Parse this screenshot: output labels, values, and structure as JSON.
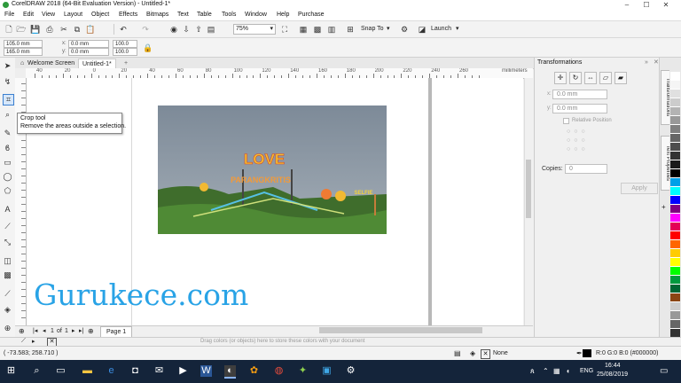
{
  "window": {
    "title": "CorelDRAW 2018 (64-Bit Evaluation Version) - Untitled-1*",
    "controls": [
      "–",
      "☐",
      "✕"
    ]
  },
  "menu": [
    "File",
    "Edit",
    "View",
    "Layout",
    "Object",
    "Effects",
    "Bitmaps",
    "Text",
    "Table",
    "Tools",
    "Window",
    "Help",
    "Purchase"
  ],
  "toolbar": {
    "zoom": "75%",
    "snap_to": "Snap To",
    "launch": "Launch"
  },
  "propbar": {
    "width": "105.0 mm",
    "height": "165.0 mm",
    "x": "0.0 mm",
    "y": "0.0 mm",
    "ox": "100.0",
    "oy": "100.0",
    "angle": "0.0"
  },
  "tabs": {
    "welcome": "Welcome Screen",
    "doc": "Untitled-1*",
    "add": "+"
  },
  "ruler": {
    "labels": [
      "40",
      "20",
      "0",
      "20",
      "40",
      "60",
      "80",
      "100",
      "120",
      "140",
      "160",
      "180",
      "200",
      "220",
      "240",
      "260"
    ],
    "unit": "millimeters"
  },
  "tooltip": {
    "title": "Crop tool",
    "description": "Remove the areas outside a selection."
  },
  "watermark": "Gurukece.com",
  "photo": {
    "sign_love": "LOVE",
    "sign_sub": "PARANGKRITIS",
    "sign_selfie": "SELFIE"
  },
  "pagenav": {
    "current": "1",
    "of": "of",
    "total": "1",
    "page_tab": "Page 1"
  },
  "docker": {
    "title": "Transformations",
    "x": "0.0 mm",
    "y": "0.0 mm",
    "relative": "Relative Position",
    "copies_label": "Copies:",
    "copies": "0",
    "apply": "Apply"
  },
  "side_tabs": {
    "transformations": "Transformations",
    "text_properties": "Text Properties"
  },
  "palette": {
    "colors": [
      "#ffffff",
      "#f5f5f5",
      "#e0e0e0",
      "#cccccc",
      "#b3b3b3",
      "#999999",
      "#808080",
      "#666666",
      "#4d4d4d",
      "#333333",
      "#1a1a1a",
      "#000000",
      "#00a0e8",
      "#00ffff",
      "#0000ff",
      "#800080",
      "#ff00ff",
      "#e40055",
      "#ff0000",
      "#ff6600",
      "#ffcc00",
      "#ffff00",
      "#00ff00",
      "#009a3e",
      "#006633",
      "#8b4513",
      "#cccccc",
      "#999999",
      "#666666",
      "#333333"
    ]
  },
  "colorbar_hint": "Drag colors (or objects) here to store these colors with your document",
  "status": {
    "coords": "( -73.583; 258.710 )",
    "fill": "None",
    "outline": "R:0 G:0 B:0 (#000000)"
  },
  "taskbar": {
    "lang": "ENG",
    "time": "16:44",
    "date": "25/08/2019"
  }
}
